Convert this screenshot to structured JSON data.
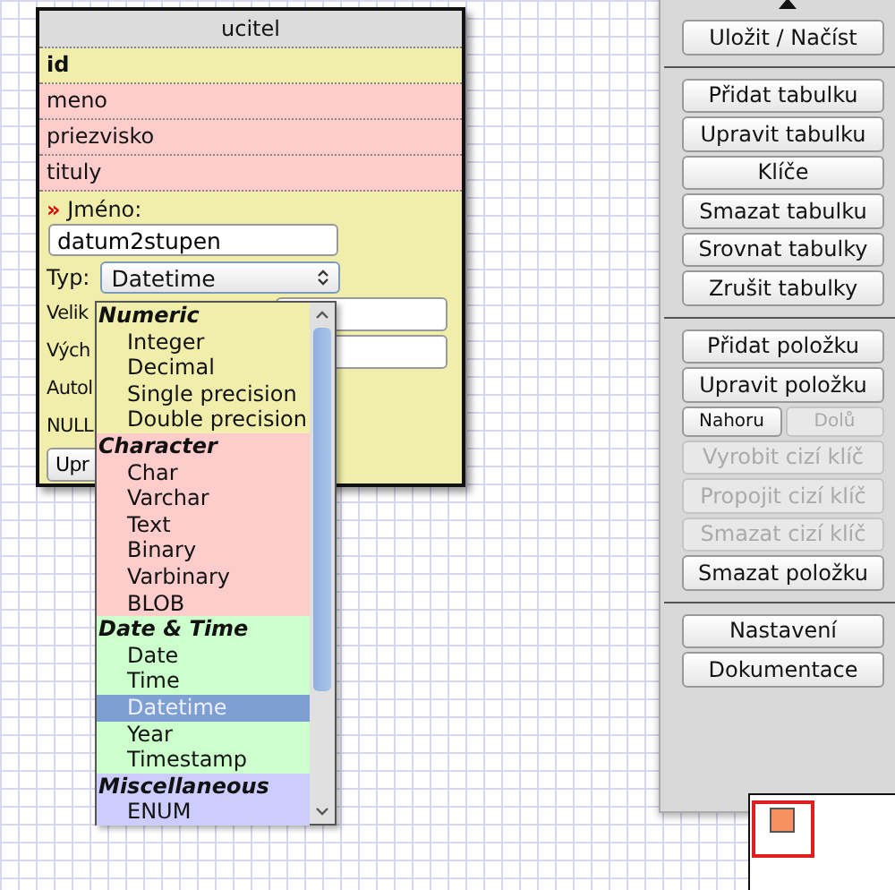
{
  "table_card": {
    "title": "ucitel",
    "fields": [
      {
        "name": "id",
        "kind": "key"
      },
      {
        "name": "meno",
        "kind": "plain"
      },
      {
        "name": "priezvisko",
        "kind": "plain"
      },
      {
        "name": "tituly",
        "kind": "plain"
      }
    ],
    "name_label": "Jméno:",
    "name_marker": "»",
    "name_value": "datum2stupen",
    "type_label": "Typ:",
    "type_value": "Datetime",
    "cut_labels": [
      "Velik",
      "Vých",
      "Autol",
      "NULL"
    ],
    "cut_button": "Upr"
  },
  "type_dropdown": {
    "groups": [
      {
        "label": "Numeric",
        "color": "#f0eeaa",
        "options": [
          {
            "label": "Integer",
            "selected": false
          },
          {
            "label": "Decimal",
            "selected": false
          },
          {
            "label": "Single precision",
            "selected": false
          },
          {
            "label": "Double precision",
            "selected": false
          }
        ]
      },
      {
        "label": "Character",
        "color": "#ffcccc",
        "options": [
          {
            "label": "Char",
            "selected": false
          },
          {
            "label": "Varchar",
            "selected": false
          },
          {
            "label": "Text",
            "selected": false
          },
          {
            "label": "Binary",
            "selected": false
          },
          {
            "label": "Varbinary",
            "selected": false
          },
          {
            "label": "BLOB",
            "selected": false
          }
        ]
      },
      {
        "label": "Date & Time",
        "color": "#ccffcc",
        "options": [
          {
            "label": "Date",
            "selected": false
          },
          {
            "label": "Time",
            "selected": false
          },
          {
            "label": "Datetime",
            "selected": true
          },
          {
            "label": "Year",
            "selected": false
          },
          {
            "label": "Timestamp",
            "selected": false
          }
        ]
      },
      {
        "label": "Miscellaneous",
        "color": "#ccccff",
        "options": [
          {
            "label": "ENUM",
            "selected": false
          }
        ]
      }
    ]
  },
  "side_panel": {
    "sections": [
      [
        {
          "kind": "button",
          "label": "Uložit / Načíst",
          "disabled": false
        }
      ],
      [
        {
          "kind": "button",
          "label": "Přidat tabulku",
          "disabled": false
        },
        {
          "kind": "button",
          "label": "Upravit tabulku",
          "disabled": false
        },
        {
          "kind": "button",
          "label": "Klíče",
          "disabled": false
        },
        {
          "kind": "button",
          "label": "Smazat tabulku",
          "disabled": false
        },
        {
          "kind": "button",
          "label": "Srovnat tabulky",
          "disabled": false
        },
        {
          "kind": "button",
          "label": "Zrušit tabulky",
          "disabled": false
        }
      ],
      [
        {
          "kind": "button",
          "label": "Přidat položku",
          "disabled": false
        },
        {
          "kind": "button",
          "label": "Upravit položku",
          "disabled": false
        },
        {
          "kind": "pair",
          "items": [
            {
              "label": "Nahoru",
              "disabled": false
            },
            {
              "label": "Dolů",
              "disabled": true
            }
          ]
        },
        {
          "kind": "button",
          "label": "Vyrobit cizí klíč",
          "disabled": true
        },
        {
          "kind": "button",
          "label": "Propojit cizí klíč",
          "disabled": true
        },
        {
          "kind": "button",
          "label": "Smazat cizí klíč",
          "disabled": true
        },
        {
          "kind": "button",
          "label": "Smazat položku",
          "disabled": false
        }
      ],
      [
        {
          "kind": "button",
          "label": "Nastavení",
          "disabled": false
        },
        {
          "kind": "button",
          "label": "Dokumentace",
          "disabled": false
        }
      ]
    ]
  }
}
